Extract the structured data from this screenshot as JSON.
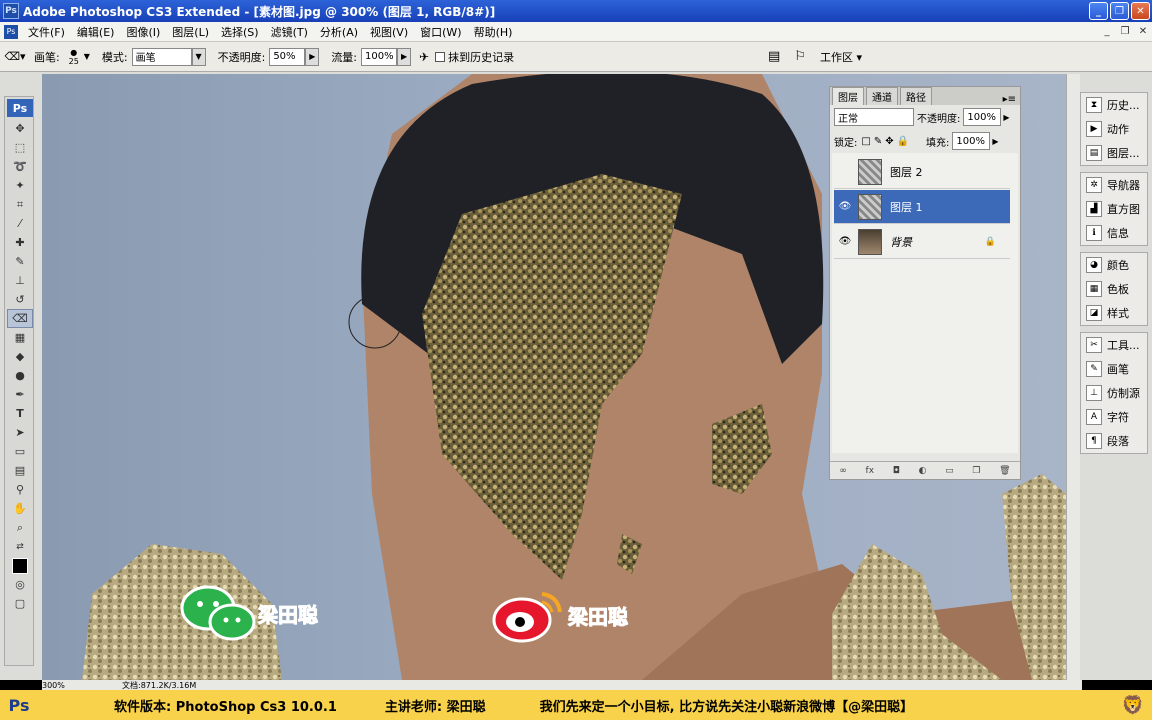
{
  "window": {
    "app_icon": "Ps",
    "title": "Adobe Photoshop CS3 Extended - [素材图.jpg @ 300% (图层 1, RGB/8#)]",
    "buttons": [
      "_",
      "❐",
      "✕"
    ]
  },
  "menu": {
    "doc_icon": "Ps",
    "items": [
      "文件(F)",
      "编辑(E)",
      "图像(I)",
      "图层(L)",
      "选择(S)",
      "滤镜(T)",
      "分析(A)",
      "视图(V)",
      "窗口(W)",
      "帮助(H)"
    ],
    "right_buttons": [
      "_",
      "❐",
      "✕"
    ]
  },
  "options": {
    "brush_label": "画笔:",
    "brush_size": "25",
    "mode_label": "模式:",
    "mode_value": "画笔",
    "opacity_label": "不透明度:",
    "opacity_value": "50%",
    "flow_label": "流量:",
    "flow_value": "100%",
    "history_label": "抹到历史记录",
    "workspace_label": "工作区 ▾"
  },
  "toolbox": {
    "logo": "Ps",
    "tools": [
      "move-icon",
      "marquee-icon",
      "lasso-icon",
      "magic-wand-icon",
      "crop-icon",
      "slice-icon",
      "healing-icon",
      "brush-icon",
      "stamp-icon",
      "history-brush-icon",
      "eraser-icon",
      "gradient-icon",
      "blur-icon",
      "dodge-icon",
      "pen-icon",
      "type-icon",
      "path-select-icon",
      "shape-icon",
      "notes-icon",
      "eyedropper-icon",
      "hand-icon",
      "zoom-icon"
    ],
    "active_index": 10
  },
  "layers": {
    "tabs": [
      "图层",
      "通道",
      "路径"
    ],
    "blend_mode": "正常",
    "opacity_label": "不透明度:",
    "opacity_value": "100%",
    "lock_label": "锁定:",
    "fill_label": "填充:",
    "fill_value": "100%",
    "items": [
      {
        "name": "图层 2",
        "visible": false,
        "active": false
      },
      {
        "name": "图层 1",
        "visible": true,
        "active": true
      },
      {
        "name": "背景",
        "visible": true,
        "active": false,
        "locked": true
      }
    ],
    "footer_icons": [
      "link-icon",
      "fx-icon",
      "mask-icon",
      "adjustment-icon",
      "group-icon",
      "new-layer-icon",
      "trash-icon"
    ]
  },
  "dock": {
    "groups": [
      [
        {
          "label": "历史...",
          "icon": "history-icon"
        },
        {
          "label": "动作",
          "icon": "actions-icon"
        },
        {
          "label": "图层...",
          "icon": "layers-icon"
        }
      ],
      [
        {
          "label": "导航器",
          "icon": "navigator-icon"
        },
        {
          "label": "直方图",
          "icon": "histogram-icon"
        },
        {
          "label": "信息",
          "icon": "info-icon"
        }
      ],
      [
        {
          "label": "颜色",
          "icon": "color-icon"
        },
        {
          "label": "色板",
          "icon": "swatches-icon"
        },
        {
          "label": "样式",
          "icon": "styles-icon"
        }
      ],
      [
        {
          "label": "工具...",
          "icon": "tool-presets-icon"
        },
        {
          "label": "画笔",
          "icon": "brushes-icon"
        },
        {
          "label": "仿制源",
          "icon": "clone-source-icon"
        },
        {
          "label": "字符",
          "icon": "character-icon"
        },
        {
          "label": "段落",
          "icon": "paragraph-icon"
        }
      ]
    ]
  },
  "status": {
    "zoom": "300%",
    "doc": "文档:871.2K/3.16M"
  },
  "watermarks": {
    "wechat_name": "梁田聪",
    "weibo_name": "梁田聪"
  },
  "banner": {
    "logo": "Ps",
    "version": "软件版本: PhotoShop Cs3 10.0.1",
    "teacher": "主讲老师: 梁田聪",
    "message": "我们先来定一个小目标, 比方说先关注小聪新浪微博【@梁田聪】"
  }
}
